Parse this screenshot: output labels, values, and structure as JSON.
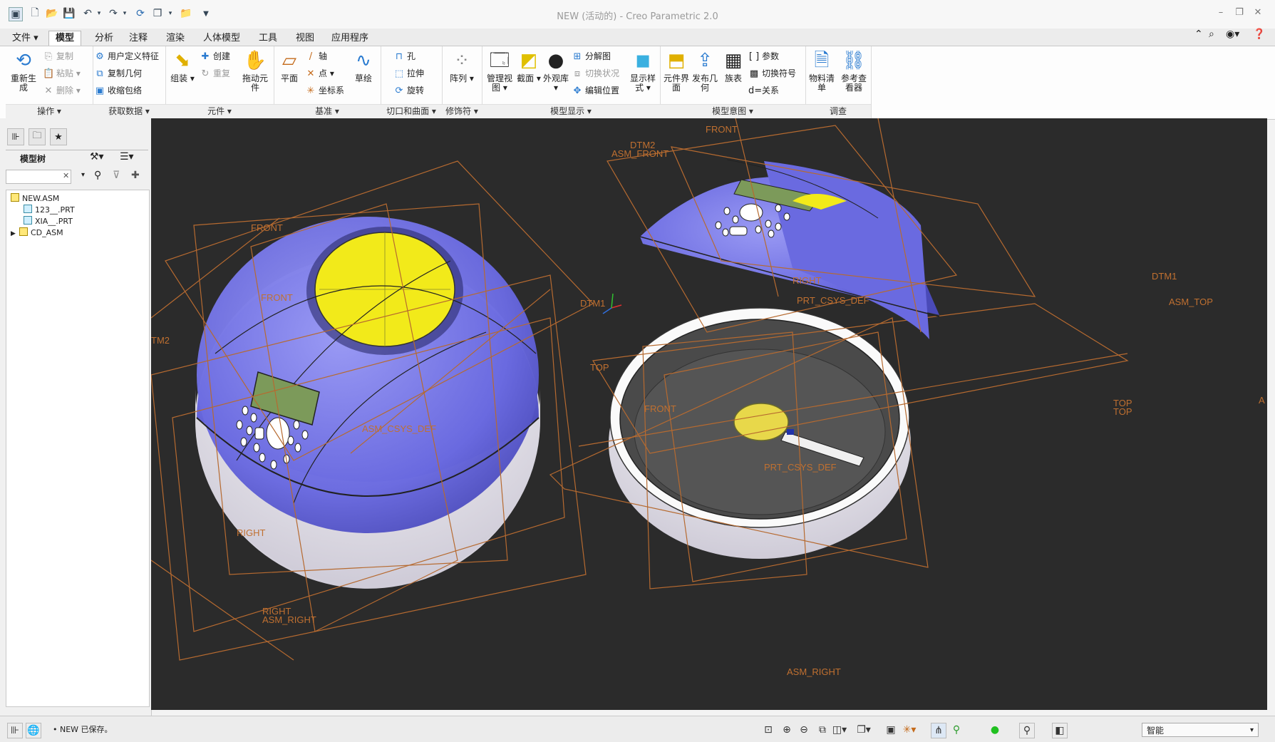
{
  "window": {
    "title": "NEW (活动的) - Creo Parametric 2.0"
  },
  "quick_access": [
    "app-icon",
    "new-icon",
    "open-icon",
    "save-icon",
    "undo-icon",
    "redo-icon",
    "regenerate-icon",
    "windows-icon",
    "close-window-icon",
    "customize-icon"
  ],
  "menu": {
    "tabs": [
      "文件",
      "模型",
      "分析",
      "注释",
      "渲染",
      "人体模型",
      "工具",
      "视图",
      "应用程序"
    ],
    "active": "模型"
  },
  "ribbon": {
    "groups": [
      "操作",
      "获取数据",
      "元件",
      "基准",
      "切口和曲面",
      "修饰符",
      "模型显示",
      "模型意图",
      "调查"
    ],
    "ops": {
      "regenerate": "重新生成",
      "copy": "复制",
      "paste": "粘贴",
      "delete": "删除"
    },
    "get_data": {
      "udf": "用户定义特征",
      "copy_geom": "复制几何",
      "shrinkwrap": "收缩包络"
    },
    "component": {
      "assemble": "组装",
      "create": "创建",
      "repeat": "重复",
      "drag": "拖动元件"
    },
    "datum": {
      "plane": "平面",
      "axis": "轴",
      "point": "点",
      "csys": "坐标系",
      "sketch": "草绘"
    },
    "cuts": {
      "hole": "孔",
      "extrude": "拉伸",
      "revolve": "旋转"
    },
    "modifiers": {
      "pattern": "阵列"
    },
    "display": {
      "manage_views": "管理视图",
      "section": "截面",
      "appearance": "外观库",
      "explode": "分解图",
      "toggle_state": "切换状况",
      "edit_position": "编辑位置",
      "display_style": "显示样式"
    },
    "intent": {
      "component_interface": "元件界面",
      "publish_geom": "发布几何",
      "family_table": "族表",
      "params": "参数",
      "switch_symbols": "切换符号",
      "relations": "关系"
    },
    "investigate": {
      "bom": "物料清单",
      "ref_viewer": "参考查看器"
    }
  },
  "model_tree": {
    "title": "模型树",
    "search_placeholder": "",
    "items": [
      {
        "label": "NEW.ASM",
        "type": "asm"
      },
      {
        "label": "123__.PRT",
        "type": "prt"
      },
      {
        "label": "XIA__.PRT",
        "type": "prt"
      },
      {
        "label": "CD_ASM",
        "type": "asm"
      }
    ]
  },
  "viewport": {
    "datum_labels": [
      "FRONT",
      "DTM2",
      "ASM_FRONT",
      "FRONT",
      "FRONT",
      "TM2",
      "DTM1",
      "TOP",
      "DTM1",
      "ASM_TOP",
      "TOP",
      "TOP",
      "FRONT",
      "RIGHT",
      "RIGHT",
      "ASM_RIGHT",
      "ASM_RIGHT",
      "RIGHT",
      "PRT_CSYS_DEF",
      "ASM_CSYS_DEF",
      "PRT_CSYS_DEF",
      "A"
    ],
    "colors": {
      "background": "#2b2b2b",
      "body": "#7b7be8",
      "disc": "#f2ea1a",
      "datum": "#b66a30",
      "shell": "#ececf2"
    }
  },
  "status": {
    "message": "• NEW 已保存。",
    "selection_filter": "智能"
  }
}
